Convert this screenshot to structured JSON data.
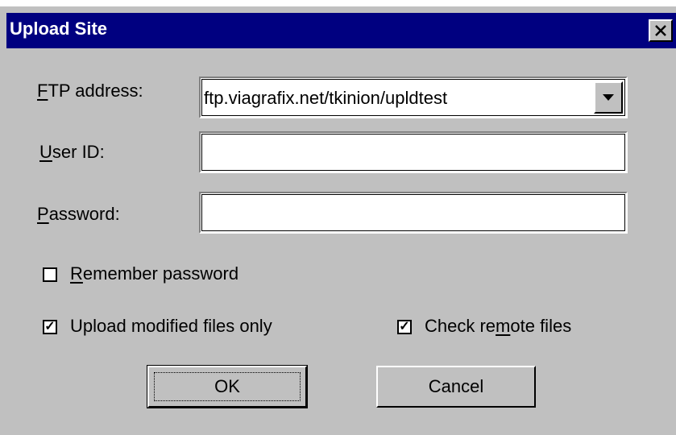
{
  "window": {
    "title": "Upload Site",
    "close_symbol": "✕"
  },
  "form": {
    "ftp_label": {
      "accel": "F",
      "rest": "TP address:"
    },
    "ftp_value": "ftp.viagrafix.net/tkinion/upldtest",
    "user_label": {
      "accel": "U",
      "rest": "ser ID:"
    },
    "user_value": "",
    "password_label": {
      "accel": "P",
      "rest": "assword:"
    },
    "password_value": ""
  },
  "options": {
    "remember": {
      "accel": "R",
      "rest": "emember password",
      "checked": false
    },
    "modified": {
      "label": "Upload modified files only",
      "checked": true
    },
    "remote": {
      "before": "Check re",
      "accel": "m",
      "after": "ote files",
      "checked": true
    }
  },
  "buttons": {
    "ok": "OK",
    "cancel": "Cancel"
  },
  "icons": {
    "close": "close-icon",
    "dropdown": "chevron-down-icon",
    "check": "checkmark-icon"
  },
  "colors": {
    "titlebar": "#000080",
    "face": "#c0c0c0"
  }
}
